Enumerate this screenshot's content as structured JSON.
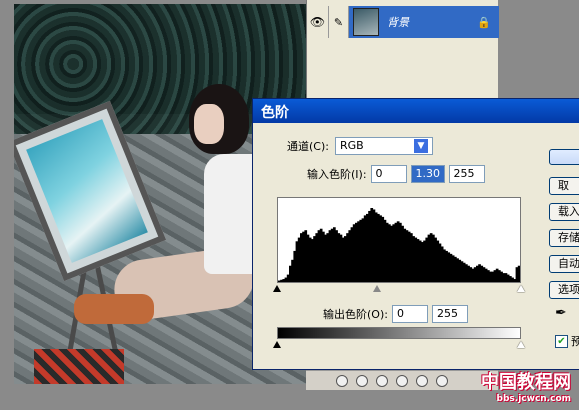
{
  "layers": {
    "layer_name": "背景"
  },
  "dialog": {
    "title": "色阶",
    "channel_label": "通道(C):",
    "channel_value": "RGB",
    "input_levels_label": "输入色阶(I):",
    "input_black": "0",
    "input_gamma": "1.30",
    "input_white": "255",
    "output_levels_label": "输出色阶(O):",
    "output_black": "0",
    "output_white": "255",
    "buttons": {
      "cancel": "取",
      "load": "载入",
      "save": "存储",
      "auto": "自动",
      "options": "选项"
    },
    "preview_label": "预",
    "histogram": [
      2,
      3,
      4,
      6,
      10,
      22,
      30,
      42,
      55,
      60,
      66,
      68,
      70,
      64,
      60,
      58,
      62,
      66,
      70,
      72,
      68,
      64,
      66,
      70,
      72,
      74,
      70,
      66,
      64,
      60,
      62,
      66,
      70,
      74,
      78,
      80,
      82,
      84,
      86,
      90,
      92,
      96,
      100,
      98,
      94,
      92,
      90,
      88,
      84,
      80,
      78,
      76,
      78,
      80,
      82,
      80,
      76,
      72,
      70,
      68,
      66,
      62,
      60,
      58,
      56,
      54,
      56,
      60,
      64,
      66,
      64,
      60,
      56,
      52,
      48,
      44,
      42,
      40,
      38,
      36,
      34,
      32,
      30,
      28,
      26,
      24,
      22,
      20,
      18,
      20,
      22,
      24,
      22,
      20,
      18,
      16,
      14,
      14,
      16,
      18,
      16,
      14,
      12,
      12,
      10,
      8,
      6,
      4,
      20,
      22
    ]
  },
  "watermark": {
    "main": "中国教程网",
    "sub": "bbs.jcwcn.com"
  },
  "colors": {
    "titlebar": "#0a5bd6",
    "selected_layer": "#316ac5",
    "dialog_bg": "#ece9d8"
  }
}
